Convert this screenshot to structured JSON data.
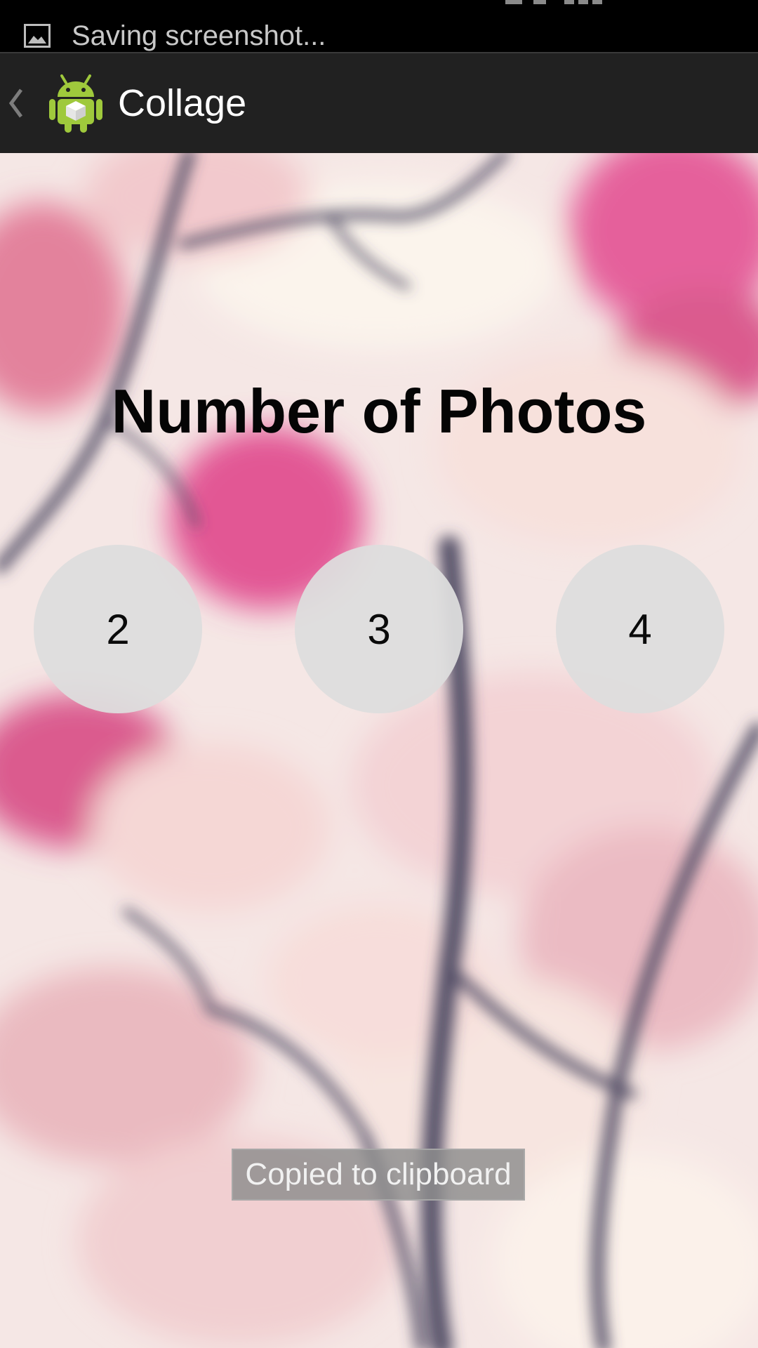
{
  "status_bar": {
    "notification_icon": "image-icon",
    "text": "Saving screenshot..."
  },
  "action_bar": {
    "up_icon": "chevron-left-icon",
    "app_icon": "android-app-icon",
    "title": "Collage"
  },
  "main": {
    "background": "blurred-pink-blossom-photo",
    "heading": "Number of Photos",
    "choices": [
      {
        "label": "2"
      },
      {
        "label": "3"
      },
      {
        "label": "4"
      }
    ]
  },
  "toast": {
    "text": "Copied to clipboard"
  },
  "colors": {
    "status_bar_bg": "#000000",
    "action_bar_bg": "#212121",
    "choice_bg": "#dddddd",
    "android_green": "#9fc93c"
  }
}
